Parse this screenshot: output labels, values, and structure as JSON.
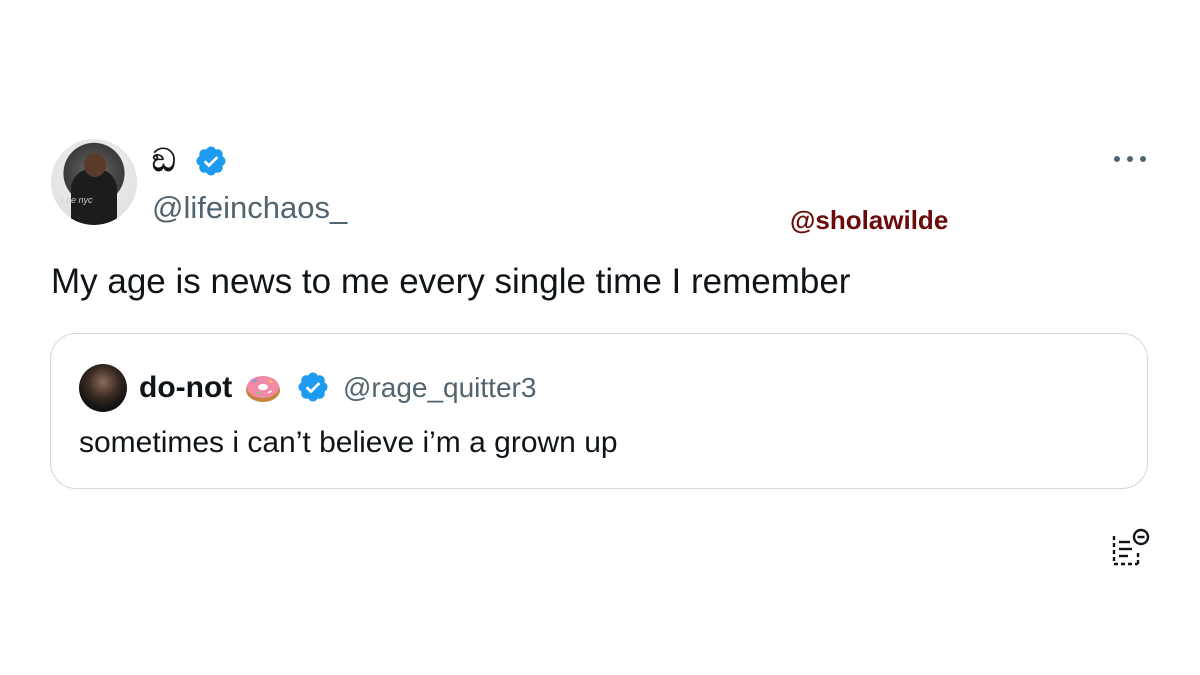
{
  "tweet": {
    "display_name": "ඞ",
    "handle": "@lifeinchaos_",
    "text": "My age is news to me every single time I remember"
  },
  "watermark": "@sholawilde",
  "quoted_tweet": {
    "display_name": "do-not",
    "handle": "@rage_quitter3",
    "text": "sometimes i can’t believe i’m a grown up"
  },
  "colors": {
    "verified": "#1d9bf0",
    "secondary_text": "#536471",
    "watermark": "#6b0a0a",
    "border": "#cfd9de"
  },
  "icons": [
    "verified-badge-icon",
    "more-icon",
    "donut-emoji-icon",
    "tweet-details-icon"
  ]
}
